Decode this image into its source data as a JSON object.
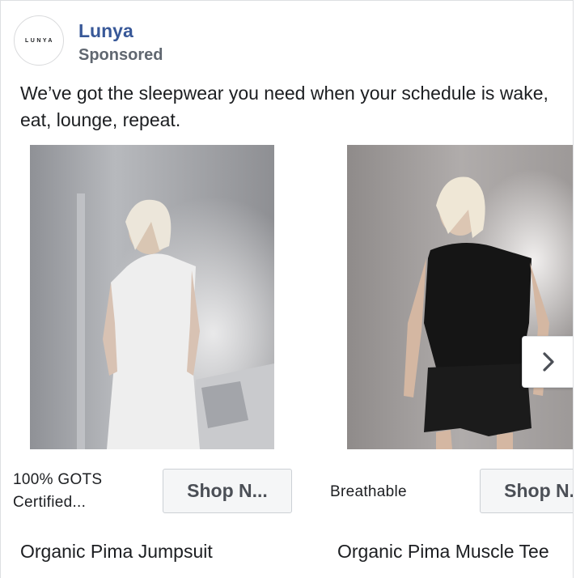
{
  "post": {
    "brand_name": "Lunya",
    "avatar_text": "LUNYA",
    "sponsored_label": "Sponsored",
    "caption": "We’ve got the sleepwear you need when your schedule is wake, eat, lounge, repeat."
  },
  "carousel": {
    "cards": [
      {
        "description": "100% GOTS Certified...",
        "button_label": "Shop N...",
        "title": "Organic Pima Jumpsuit"
      },
      {
        "description": "Breathable",
        "button_label": "Shop N...",
        "title": "Organic Pima Muscle Tee"
      }
    ],
    "next_icon": "chevron-right-icon"
  }
}
